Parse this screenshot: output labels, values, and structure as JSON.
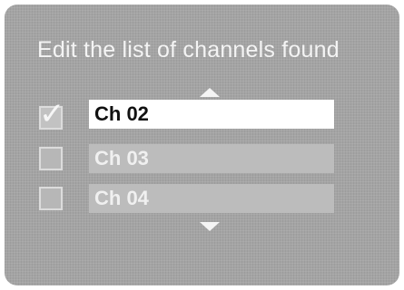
{
  "title": "Edit the list of channels found",
  "scroll": {
    "up_icon": "triangle-up-icon",
    "down_icon": "triangle-down-icon"
  },
  "channels": [
    {
      "label": "Ch 02",
      "checked": true,
      "selected": true
    },
    {
      "label": "Ch 03",
      "checked": false,
      "selected": false
    },
    {
      "label": "Ch 04",
      "checked": false,
      "selected": false
    }
  ],
  "colors": {
    "background": "#a4a4a4",
    "highlight": "#ffffff",
    "row": "#bcbcbc",
    "text_light": "#f4f4f4"
  }
}
